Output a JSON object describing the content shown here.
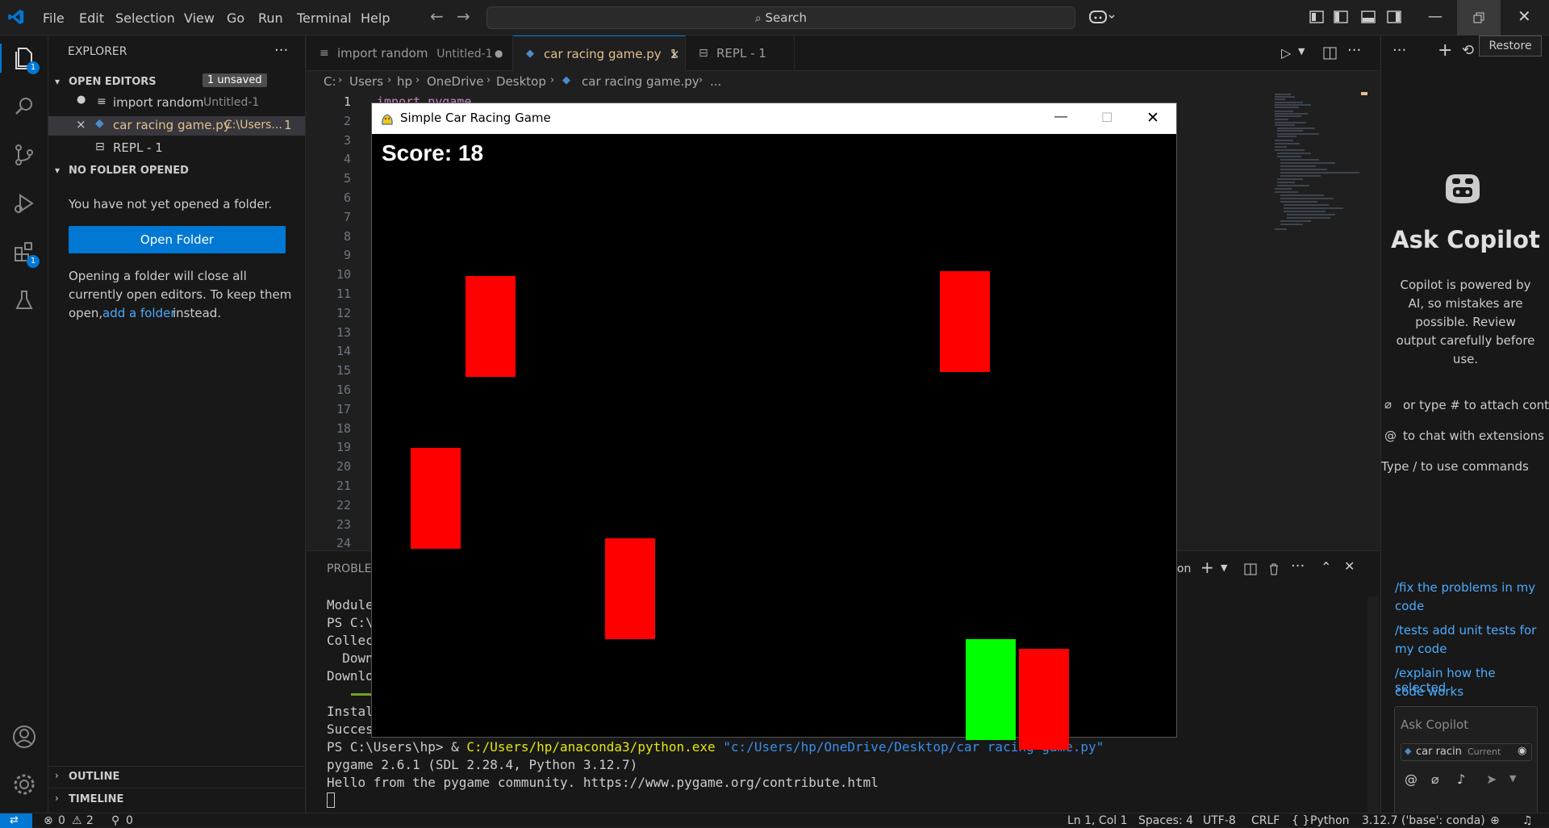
{
  "menu": [
    "File",
    "Edit",
    "Selection",
    "View",
    "Go",
    "Run",
    "Terminal",
    "Help"
  ],
  "search": {
    "label": "Search"
  },
  "restore_tooltip": "Restore",
  "activity_badges": {
    "explorer": "1",
    "extensions": "1"
  },
  "sidebar": {
    "title": "EXPLORER",
    "open_editors_label": "OPEN EDITORS",
    "unsaved_badge": "1 unsaved",
    "open_editors": [
      {
        "name": "import random",
        "detail": "Untitled-1",
        "badge": ""
      },
      {
        "name": "car racing game.py",
        "detail": "C:\\Users...",
        "badge": "1"
      },
      {
        "name": "REPL - 1",
        "detail": "",
        "badge": ""
      }
    ],
    "no_folder_label": "NO FOLDER OPENED",
    "no_folder_msg": "You have not yet opened a folder.",
    "open_folder_button": "Open Folder",
    "folder_hint_1": "Opening a folder will close all",
    "folder_hint_2": "currently open editors. To keep them",
    "folder_hint_3": "open,",
    "folder_hint_link": "add a folder",
    "folder_hint_4": "instead.",
    "outline_label": "OUTLINE",
    "timeline_label": "TIMELINE"
  },
  "tabs": [
    {
      "name": "import random",
      "detail": "Untitled-1"
    },
    {
      "name": "car racing game.py",
      "badge": "1"
    },
    {
      "name": "REPL - 1"
    }
  ],
  "breadcrumb": [
    "C:",
    "Users",
    "hp",
    "OneDrive",
    "Desktop",
    "car racing game.py",
    "..."
  ],
  "editor": {
    "first_line_code": "import pygame",
    "line_numbers": [
      "1",
      "2",
      "3",
      "4",
      "5",
      "6",
      "7",
      "8",
      "9",
      "10",
      "11",
      "12",
      "13",
      "14",
      "15",
      "16",
      "17",
      "18",
      "19",
      "20",
      "21",
      "22",
      "23",
      "24"
    ]
  },
  "panel": {
    "problems_tab": "PROBLEM",
    "right_label": "ion",
    "terminal_lines_partial": [
      "Module",
      "PS C:\\",
      "Collec",
      "  Down",
      "Downlo",
      "",
      "Instal",
      "Succes"
    ],
    "prompt": "PS C:\\Users\\hp> & ",
    "exe_path": "C:/Users/hp/anaconda3/python.exe",
    "script_path": "\"c:/Users/hp/OneDrive/Desktop/car racing game.py\"",
    "line_pygame": "pygame 2.6.1 (SDL 2.28.4, Python 3.12.7)",
    "line_hello": "Hello from the pygame community. https://www.pygame.org/contribute.html"
  },
  "game": {
    "window_title": "Simple Car Racing Game",
    "score_text": "Score: 18",
    "player_color": "#00ff00",
    "enemy_color": "#ff0000"
  },
  "copilot": {
    "title": "Ask Copilot",
    "desc_1": "Copilot is powered by",
    "desc_2": "AI, so mistakes are",
    "desc_3": "possible. Review",
    "desc_4": "output carefully before",
    "desc_5": "use.",
    "hint_attach": "or type # to attach context",
    "hint_extensions": "to chat with extensions",
    "hint_commands": "Type / to use commands",
    "sugg_1a": "/fix the problems in my",
    "sugg_1b": "code",
    "sugg_2a": "/tests add unit tests for",
    "sugg_2b": "my code",
    "sugg_3a": "/explain how the selected",
    "sugg_3b": "code works",
    "input_placeholder": "Ask Copilot",
    "context_file": "car racin",
    "context_current": "Current"
  },
  "statusbar": {
    "errors": "0",
    "warnings": "2",
    "ports": "0",
    "position": "Ln 1, Col 1",
    "spaces": "Spaces: 4",
    "encoding": "UTF-8",
    "eol": "CRLF",
    "language": "Python",
    "interpreter": "3.12.7 ('base': conda)"
  },
  "colors": {
    "accent": "#0078d4",
    "link": "#4daafc",
    "modified_tab": "#e2c08d"
  }
}
